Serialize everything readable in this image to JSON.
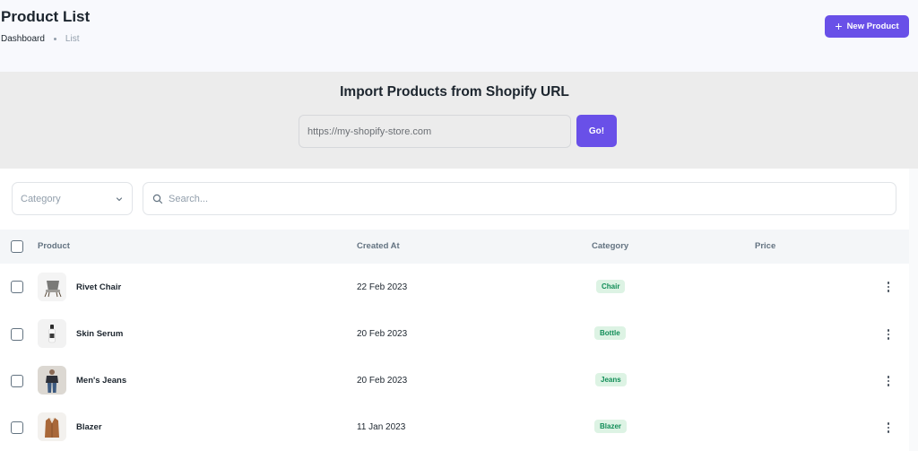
{
  "header": {
    "title": "Product List",
    "breadcrumb": [
      "Dashboard",
      "List"
    ],
    "new_product_label": "New Product"
  },
  "import": {
    "title": "Import Products from Shopify URL",
    "url_placeholder": "https://my-shopify-store.com",
    "go_label": "Go!"
  },
  "filters": {
    "category_placeholder": "Category",
    "search_placeholder": "Search..."
  },
  "table": {
    "columns": [
      "Product",
      "Created At",
      "Category",
      "Price"
    ],
    "rows": [
      {
        "name": "Rivet Chair",
        "created_at": "22 Feb 2023",
        "category": "Chair",
        "price": "",
        "thumb_icon": "chair-icon"
      },
      {
        "name": "Skin Serum",
        "created_at": "20 Feb 2023",
        "category": "Bottle",
        "price": "",
        "thumb_icon": "bottle-icon"
      },
      {
        "name": "Men's Jeans",
        "created_at": "20 Feb 2023",
        "category": "Jeans",
        "price": "",
        "thumb_icon": "jeans-icon"
      },
      {
        "name": "Blazer",
        "created_at": "11 Jan 2023",
        "category": "Blazer",
        "price": "",
        "thumb_icon": "blazer-icon"
      }
    ]
  },
  "colors": {
    "accent": "#6950e8",
    "badge_bg": "#ddf3e4",
    "badge_text": "#118d57"
  }
}
